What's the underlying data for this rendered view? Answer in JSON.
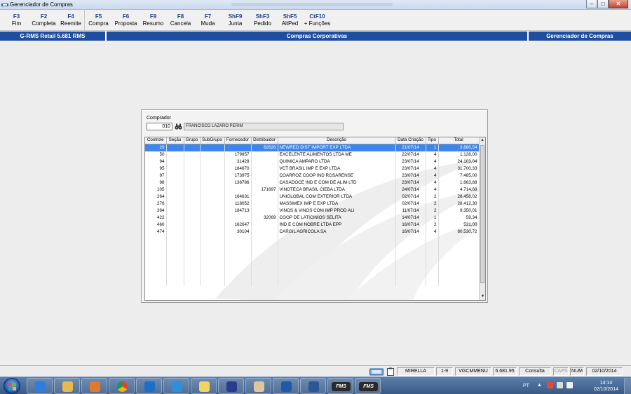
{
  "window": {
    "title": "Gerenciador de Compras"
  },
  "fkeys": [
    {
      "key": "F3",
      "label": "Fim"
    },
    {
      "key": "F2",
      "label": "Completa"
    },
    {
      "key": "F4",
      "label": "Reemite"
    },
    {
      "key": "F5",
      "label": "Compra"
    },
    {
      "key": "F6",
      "label": "Proposta"
    },
    {
      "key": "F9",
      "label": "Resumo"
    },
    {
      "key": "F8",
      "label": "Cancela"
    },
    {
      "key": "F7",
      "label": "Muda"
    },
    {
      "key": "ShF9",
      "label": "Junta"
    },
    {
      "key": "ShF3",
      "label": "Pedido"
    },
    {
      "key": "ShF5",
      "label": "AltPed"
    },
    {
      "key": "CtF10",
      "label": "+ Funções"
    }
  ],
  "band": {
    "left": "G-RMS Retail 5.681 RMS",
    "center": "Compras Corporativas",
    "right": "Gerenciador de Compras"
  },
  "buyer": {
    "label": "Comprador",
    "code": "010",
    "name": "FRANCISCO LAZARO PERIM"
  },
  "table": {
    "headers": [
      "Controle",
      "Seção",
      "Grupo",
      "SubGrupo",
      "Fornecedor",
      "Distribuidor",
      "Descrição",
      "Data Criação",
      "Tipo",
      "Total"
    ],
    "rows": [
      [
        "29",
        "",
        "",
        "",
        "",
        "62626",
        "NEWRED DIST IMPORT EXP LTDA",
        "21/07/14",
        "1",
        "3.880,54"
      ],
      [
        "50",
        "",
        "",
        "",
        "179957",
        "",
        "EXCELENTE ALIMENTOS LTDA ME",
        "22/07/14",
        "4",
        "1.128,00"
      ],
      [
        "94",
        "",
        "",
        "",
        "31429",
        "",
        "QUIMICA AMPARO LTDA",
        "23/07/14",
        "4",
        "24.103,04"
      ],
      [
        "95",
        "",
        "",
        "",
        "184670",
        "",
        "VCT BRASIL IMP E EXP LTDA",
        "23/07/14",
        "4",
        "31.700,33"
      ],
      [
        "97",
        "",
        "",
        "",
        "173975",
        "",
        "COARROZ COOP IND ROSARENSE",
        "23/07/14",
        "4",
        "7.485,00"
      ],
      [
        "98",
        "",
        "",
        "",
        "136786",
        "",
        "CASADOCE IND E COM DE ALIM LTD",
        "23/07/14",
        "4",
        "1.663,88"
      ],
      [
        "105",
        "",
        "",
        "",
        "",
        "171697",
        "VINOTECA BRASIL CIEBA LTDA",
        "24/07/14",
        "4",
        "4.714,68"
      ],
      [
        "264",
        "",
        "",
        "",
        "164631",
        "",
        "UNIGLOBAL COM EXTERIOR LTDA",
        "02/07/14",
        "2",
        "28.458,02"
      ],
      [
        "276",
        "",
        "",
        "",
        "118052",
        "",
        "MASSIMEX IMP E EXP LTDA",
        "02/07/14",
        "2",
        "28.412,30"
      ],
      [
        "394",
        "",
        "",
        "",
        "184713",
        "",
        "VINOS & VINOS COM IMP PROD ALI",
        "11/07/14",
        "2",
        "9.350,01"
      ],
      [
        "422",
        "",
        "",
        "",
        "",
        "32069",
        "COOP DE LATICINIOS SELITA",
        "14/07/14",
        "1",
        "59,34"
      ],
      [
        "460",
        "",
        "",
        "",
        "162647",
        "",
        "IND E COM NOBRE LTDA EPP",
        "16/07/14",
        "2",
        "531,00"
      ],
      [
        "474",
        "",
        "",
        "",
        "30104",
        "",
        "CARGIL AGRICOLA SA",
        "16/07/14",
        "4",
        "80.530,72"
      ]
    ],
    "selected_row": 0
  },
  "status": {
    "user": "MIRELLA",
    "range": "1-9",
    "menu": "VGCMMENU",
    "version": "5.681.95",
    "mode": "Consulta",
    "caps": "CAPS",
    "num": "NUM",
    "date": "02/10/2014"
  },
  "taskbar": {
    "items": [
      "ie-icon",
      "explorer-icon",
      "media-player-icon",
      "chrome-icon",
      "outlook-icon",
      "lync-icon",
      "sticky-notes-icon",
      "network-icon",
      "paint-icon",
      "remote-icon",
      "word-icon",
      "FMS",
      "FMS"
    ],
    "lang": "PT",
    "time": "14:14",
    "date": "02/10/2014"
  },
  "colors": {
    "band": "#1f4d9f",
    "selection": "#3c86f2",
    "fkey": "#1f3f8e"
  }
}
